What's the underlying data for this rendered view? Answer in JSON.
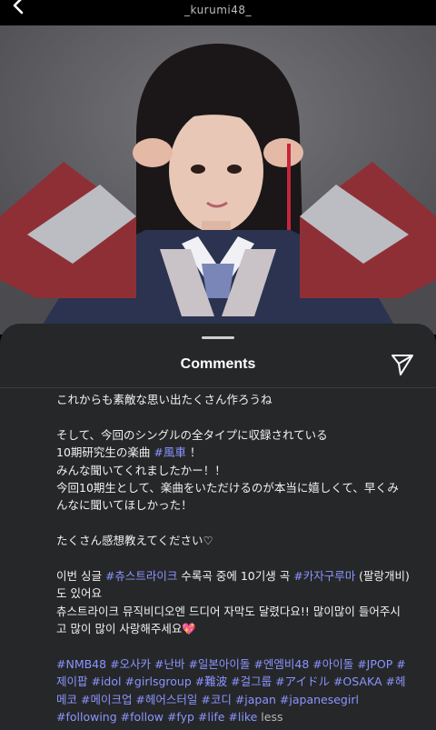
{
  "header": {
    "username": "_kurumi48_"
  },
  "icons": {
    "back": "chevron-left-icon",
    "send": "send-paper-plane-icon",
    "heart": "pink-heart-emoji"
  },
  "comments_sheet": {
    "title": "Comments",
    "caption": {
      "l1": "これからも素敵な思い出たくさん作ろうね",
      "l2": "そして、今回のシングルの全タイプに収録されている",
      "l3a": "10期研究生の楽曲 ",
      "l3tag": "#風車",
      "l3b": " ！",
      "l4": "みんな聞いてくれましたかー！！",
      "l5": "今回10期生として、楽曲をいただけるのが本当に嬉しくて、早くみ",
      "l6": "んなに聞いてほしかった！",
      "l7": "たくさん感想教えてください♡",
      "l8a": "이번 싱글 ",
      "l8tag1": "#츄스트라이크",
      "l8b": " 수록곡 중에 10기생 곡 ",
      "l8tag2": "#카자구루마",
      "l8c": " (팔랑개비)",
      "l9": "도 있어요",
      "l10": "츄스트라이크 뮤직비디오엔 드디어 자막도 달렸다요!! 많이많이 들어주시",
      "l11a": "고 많이 많이 사랑해주세요",
      "l11heart": "💖",
      "h1": "#NMB48 #오사카 #난바 #일본아이돌 #엔엠비48 #아이돌 #JPOP #",
      "h2": "제이팝 #idol #girlsgroup #難波 #걸그룹 #アイドル #OSAKA #헤",
      "h3": "메코 #메이크업 #헤어스터일 #코디 #japan #japanesegirl",
      "h4": "#following #follow #fyp #life #like",
      "less": " less"
    }
  }
}
